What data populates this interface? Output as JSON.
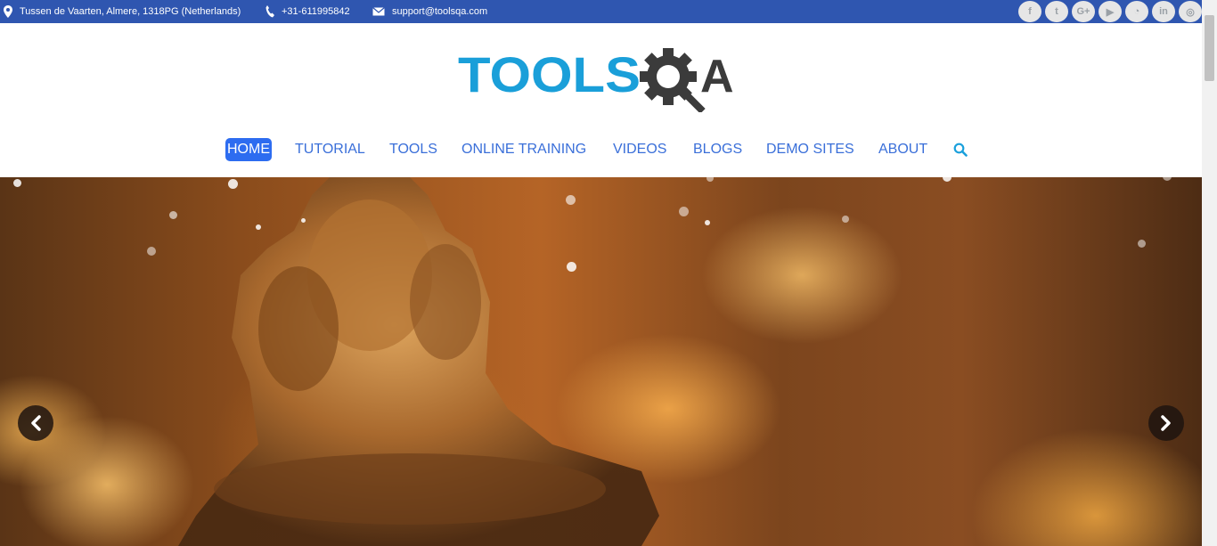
{
  "topbar": {
    "address": "Tussen de Vaarten, Almere, 1318PG (Netherlands)",
    "phone": "+31-611995842",
    "email": "support@toolsqa.com",
    "address_icon": "location-pin-icon",
    "phone_icon": "phone-icon",
    "email_icon": "envelope-icon",
    "social": [
      {
        "name": "facebook-icon",
        "glyph": "f"
      },
      {
        "name": "twitter-icon",
        "glyph": "t"
      },
      {
        "name": "google-plus-icon",
        "glyph": "G+"
      },
      {
        "name": "youtube-icon",
        "glyph": "▶"
      },
      {
        "name": "rss-icon",
        "glyph": "◔"
      },
      {
        "name": "linkedin-icon",
        "glyph": "in"
      },
      {
        "name": "instagram-icon",
        "glyph": "◎"
      }
    ]
  },
  "logo": {
    "left": "TOOLS",
    "right": "A",
    "colors": {
      "tools": "#1a9fd9",
      "qa": "#3b3b3b"
    }
  },
  "nav": {
    "items": [
      "HOME",
      "TUTORIAL",
      "TOOLS",
      "ONLINE TRAINING",
      "VIDEOS",
      "BLOGS",
      "DEMO SITES",
      "ABOUT"
    ],
    "search_icon": "search-icon",
    "active": "HOME",
    "colors": {
      "link": "#3a6fd9",
      "active_bg": "#2d6cf0"
    }
  },
  "hero": {
    "prev_icon": "chevron-left-icon",
    "next_icon": "chevron-right-icon"
  },
  "colors": {
    "topbar": "#2f56b0"
  }
}
